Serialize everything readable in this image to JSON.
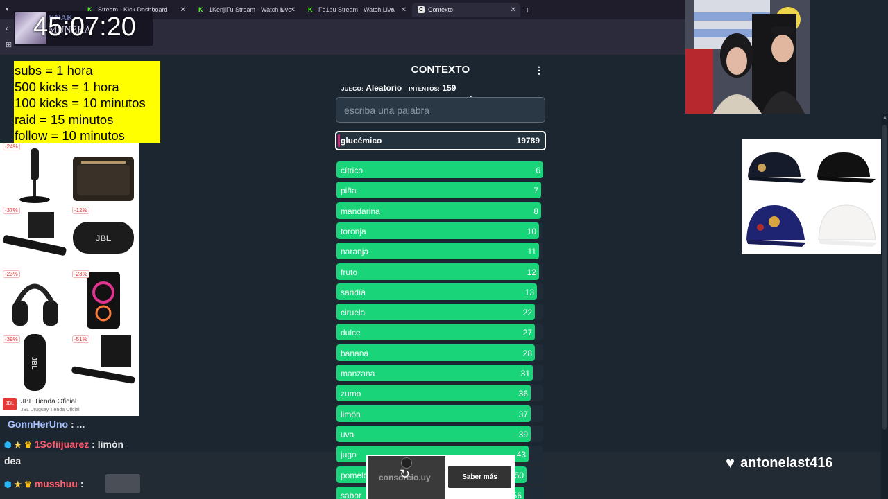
{
  "browser": {
    "tabs": [
      {
        "label": "Stream - Kick Dashboard"
      },
      {
        "label": "1KenjiFu Stream - Watch Live"
      },
      {
        "label": "Fe1bu Stream - Watch Live"
      },
      {
        "label": "Contexto"
      }
    ]
  },
  "overlay": {
    "timer": "45:07:20",
    "timer_sub1": "KNAK",
    "timer_sub2": "MUNEKA",
    "rules": [
      "subs = 1 hora",
      "500 kicks = 1 hora",
      "100 kicks = 10 minutos",
      "raid = 15 minutos",
      "follow = 10 minutos"
    ],
    "follower_name": "antonelast416"
  },
  "ad_left": {
    "badges": [
      "-24%",
      "-37%",
      "-12%",
      "-23%",
      "-23%",
      "-39%",
      "-51%"
    ],
    "brand": "JBL Tienda Oficial",
    "brand_sub": "JBL Uruguay Tienda Oficial"
  },
  "chat": [
    {
      "user": "GonnHerUno",
      "message": ": ..."
    },
    {
      "user": "1Sofiijuarez",
      "message": ": limón"
    },
    {
      "user": "",
      "message": "dea"
    },
    {
      "user": "musshuu",
      "message": ":"
    }
  ],
  "game": {
    "title": "CONTEXTO",
    "game_label": "JUEGO:",
    "game_value": "Aleatorio",
    "attempts_label": "INTENTOS:",
    "attempts_value": "159",
    "input_placeholder": "escriba una palabra",
    "current_guess": {
      "word": "glucémico",
      "rank": "19789"
    },
    "guesses": [
      {
        "word": "cítrico",
        "rank": "6",
        "fill": 1.0
      },
      {
        "word": "piña",
        "rank": "7",
        "fill": 0.99
      },
      {
        "word": "mandarina",
        "rank": "8",
        "fill": 0.99
      },
      {
        "word": "toronja",
        "rank": "10",
        "fill": 0.98
      },
      {
        "word": "naranja",
        "rank": "11",
        "fill": 0.98
      },
      {
        "word": "fruto",
        "rank": "12",
        "fill": 0.98
      },
      {
        "word": "sandía",
        "rank": "13",
        "fill": 0.97
      },
      {
        "word": "ciruela",
        "rank": "22",
        "fill": 0.96
      },
      {
        "word": "dulce",
        "rank": "27",
        "fill": 0.96
      },
      {
        "word": "banana",
        "rank": "28",
        "fill": 0.96
      },
      {
        "word": "manzana",
        "rank": "31",
        "fill": 0.95
      },
      {
        "word": "zumo",
        "rank": "36",
        "fill": 0.94
      },
      {
        "word": "limón",
        "rank": "37",
        "fill": 0.94
      },
      {
        "word": "uva",
        "rank": "39",
        "fill": 0.94
      },
      {
        "word": "jugo",
        "rank": "43",
        "fill": 0.93
      },
      {
        "word": "pomelo",
        "rank": "50",
        "fill": 0.92
      },
      {
        "word": "sabor",
        "rank": "56",
        "fill": 0.91
      }
    ]
  },
  "popup": {
    "image_text": "consorcio.uy",
    "button": "Saber más"
  },
  "colors": {
    "page_bg": "#1b2631",
    "row_green": "#19d479",
    "rules_bg": "#ffff00"
  }
}
